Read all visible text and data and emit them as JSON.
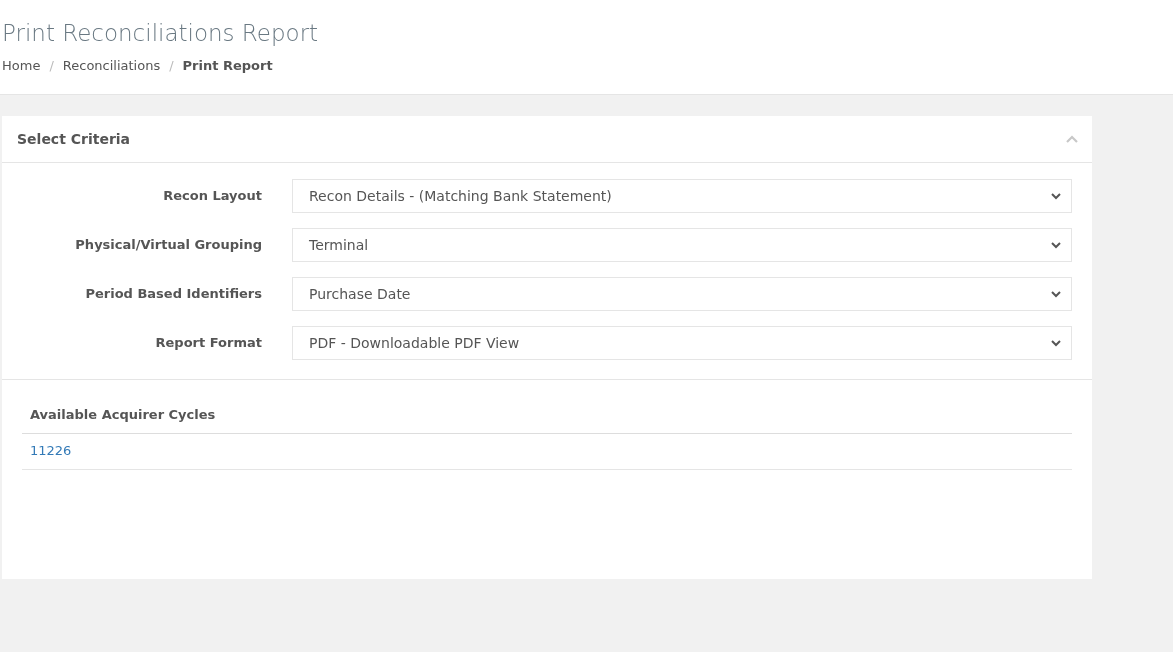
{
  "page_title": "Print Reconciliations Report",
  "breadcrumb": [
    {
      "label": "Home",
      "current": false
    },
    {
      "separator": "/",
      "label": "Reconciliations",
      "current": false
    },
    {
      "separator": "/",
      "label": "Print Report",
      "current": true
    }
  ],
  "panel": {
    "title": "Select Criteria",
    "expanded": true,
    "fields": [
      {
        "label": "Recon Layout",
        "value": "Recon Details - (Matching Bank Statement)"
      },
      {
        "label": "Physical/Virtual Grouping",
        "value": "Terminal"
      },
      {
        "label": "Period Based Identifiers",
        "value": "Purchase Date"
      },
      {
        "label": "Report Format",
        "value": "PDF - Downloadable PDF View"
      }
    ],
    "table": {
      "columns": [
        "Available Acquirer Cycles"
      ],
      "rows": [
        [
          "11226"
        ]
      ]
    }
  }
}
